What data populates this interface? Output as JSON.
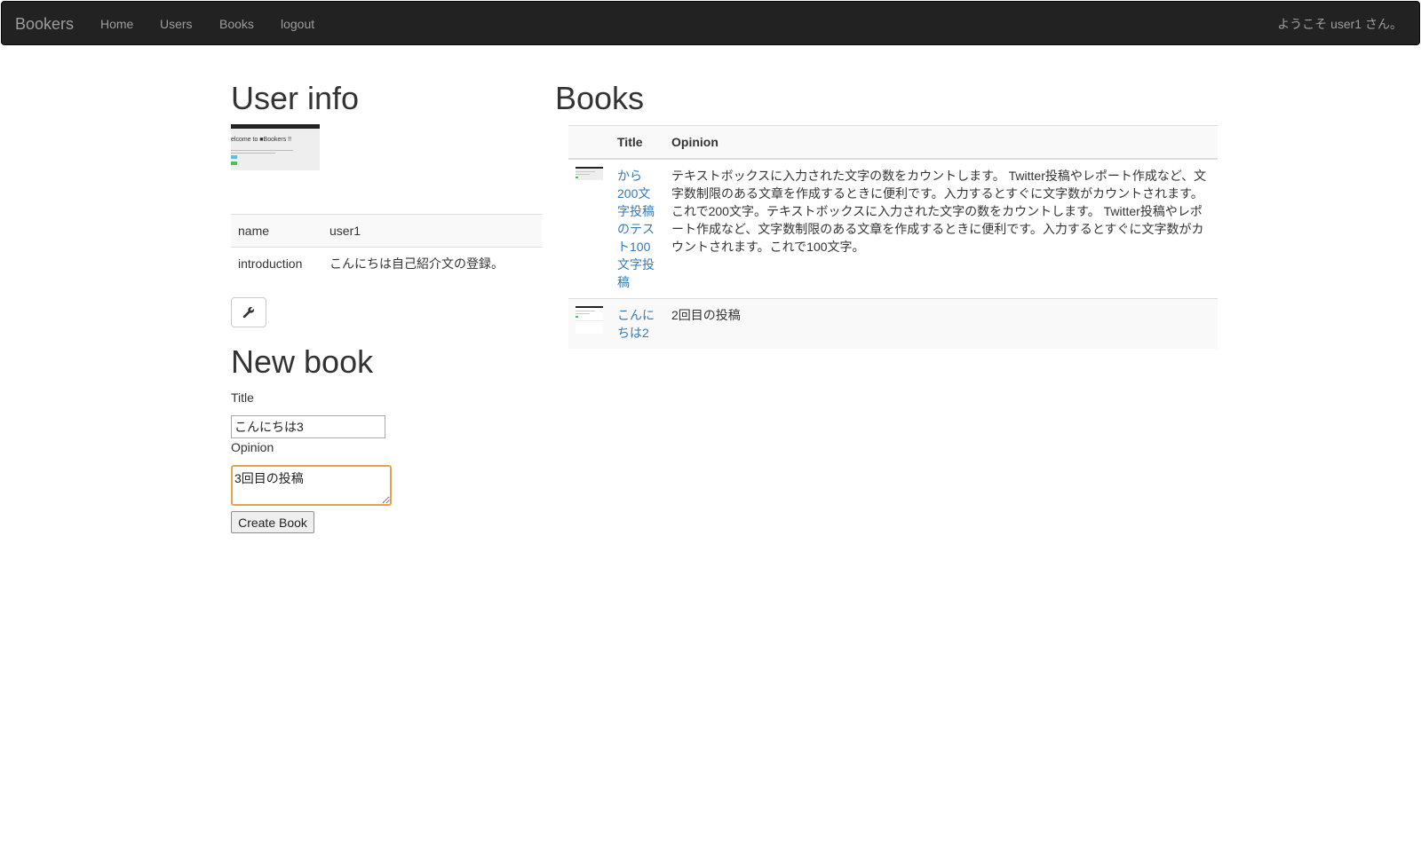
{
  "navbar": {
    "brand": "Bookers",
    "links": [
      "Home",
      "Users",
      "Books",
      "logout"
    ],
    "welcome": "ようこそ user1 さん。"
  },
  "user_info": {
    "heading": "User info",
    "avatar_caption": "elcome to ■Bookers !!",
    "rows": [
      {
        "key": "name",
        "value": "user1"
      },
      {
        "key": "introduction",
        "value": "こんにちは自己紹介文の登録。"
      }
    ],
    "edit_icon": "wrench-icon"
  },
  "new_book": {
    "heading": "New book",
    "title_label": "Title",
    "title_value": "こんにちは3",
    "opinion_label": "Opinion",
    "opinion_value": "3回目の投稿",
    "submit_label": "Create Book"
  },
  "books": {
    "heading": "Books",
    "columns": [
      "",
      "Title",
      "Opinion"
    ],
    "rows": [
      {
        "title": "から200文字投稿のテスト100文字投稿",
        "opinion": "テキストボックスに入力された文字の数をカウントします。 Twitter投稿やレポート作成など、文字数制限のある文章を作成するときに便利です。入力するとすぐに文字数がカウントされます。これで200文字。テキストボックスに入力された文字の数をカウントします。 Twitter投稿やレポート作成など、文字数制限のある文章を作成するときに便利です。入力するとすぐに文字数がカウントされます。これで100文字。"
      },
      {
        "title": "こんにちは2",
        "opinion": "2回目の投稿"
      }
    ]
  },
  "colors": {
    "navbar_bg": "#222222",
    "nav_text": "#9d9d9d",
    "link": "#337ab7",
    "focus_border": "#e2a54b"
  }
}
